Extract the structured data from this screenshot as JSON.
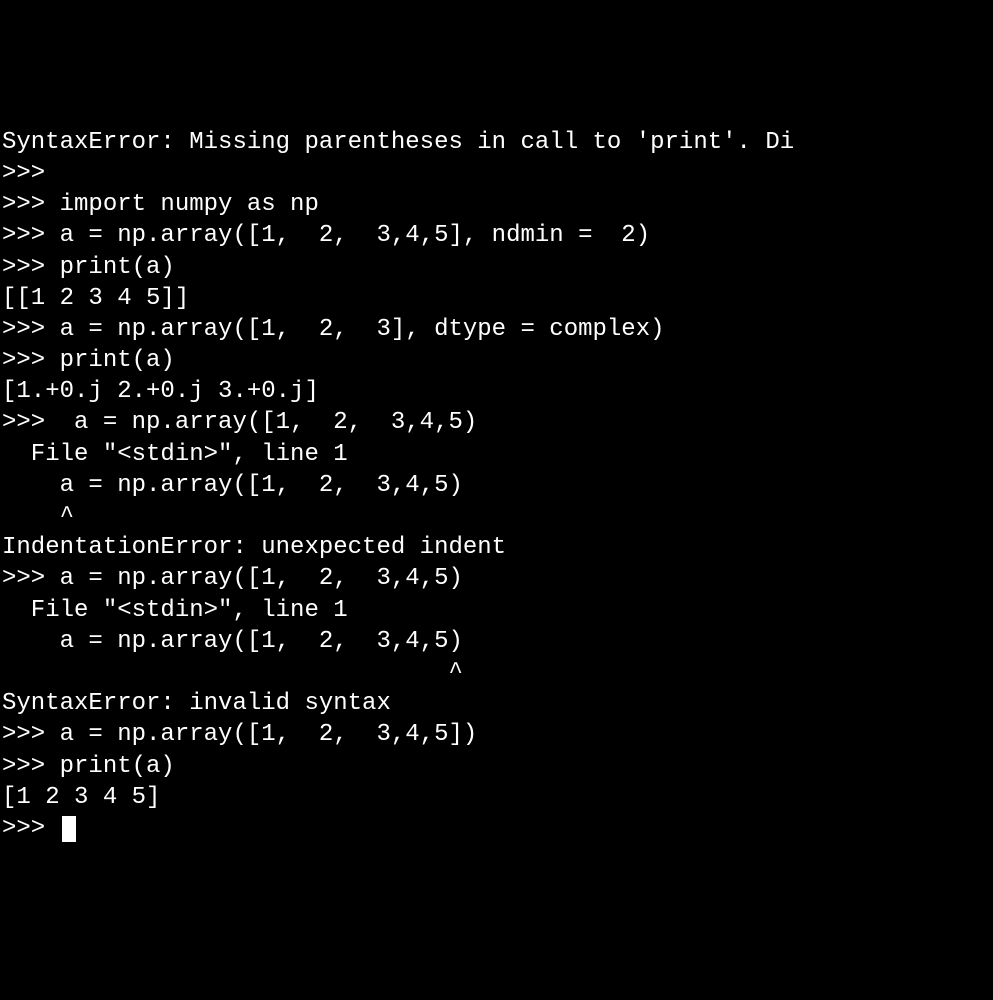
{
  "terminal": {
    "lines": [
      "SyntaxError: Missing parentheses in call to 'print'. Di",
      ">>>",
      ">>> import numpy as np",
      ">>> a = np.array([1,  2,  3,4,5], ndmin =  2)",
      ">>> print(a)",
      "[[1 2 3 4 5]]",
      ">>> a = np.array([1,  2,  3], dtype = complex)",
      ">>> print(a)",
      "[1.+0.j 2.+0.j 3.+0.j]",
      ">>>  a = np.array([1,  2,  3,4,5)",
      "  File \"<stdin>\", line 1",
      "    a = np.array([1,  2,  3,4,5)",
      "    ^",
      "IndentationError: unexpected indent",
      ">>> a = np.array([1,  2,  3,4,5)",
      "  File \"<stdin>\", line 1",
      "    a = np.array([1,  2,  3,4,5)",
      "                               ^",
      "SyntaxError: invalid syntax",
      ">>> a = np.array([1,  2,  3,4,5])",
      ">>> print(a)",
      "[1 2 3 4 5]",
      ">>> "
    ],
    "prompt": ">>> "
  }
}
